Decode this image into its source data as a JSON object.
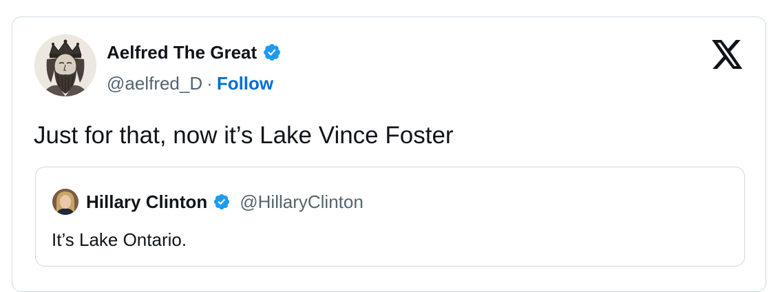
{
  "tweet": {
    "author": {
      "display_name": "Aelfred The Great",
      "handle": "@aelfred_D",
      "separator": "·",
      "follow_label": "Follow",
      "verified": true,
      "avatar_icon": "king-portrait-avatar"
    },
    "text": "Just for that, now it’s Lake Vince Foster",
    "platform_icon": "x-logo-icon"
  },
  "quoted_tweet": {
    "author": {
      "display_name": "Hillary Clinton",
      "handle": "@HillaryClinton",
      "verified": true,
      "avatar_icon": "profile-photo-avatar"
    },
    "text": "It’s Lake Ontario."
  },
  "colors": {
    "verified_badge": "#1d9bf0",
    "follow_link": "#006fd6",
    "secondary_text": "#536471",
    "border": "#cfd9de"
  }
}
